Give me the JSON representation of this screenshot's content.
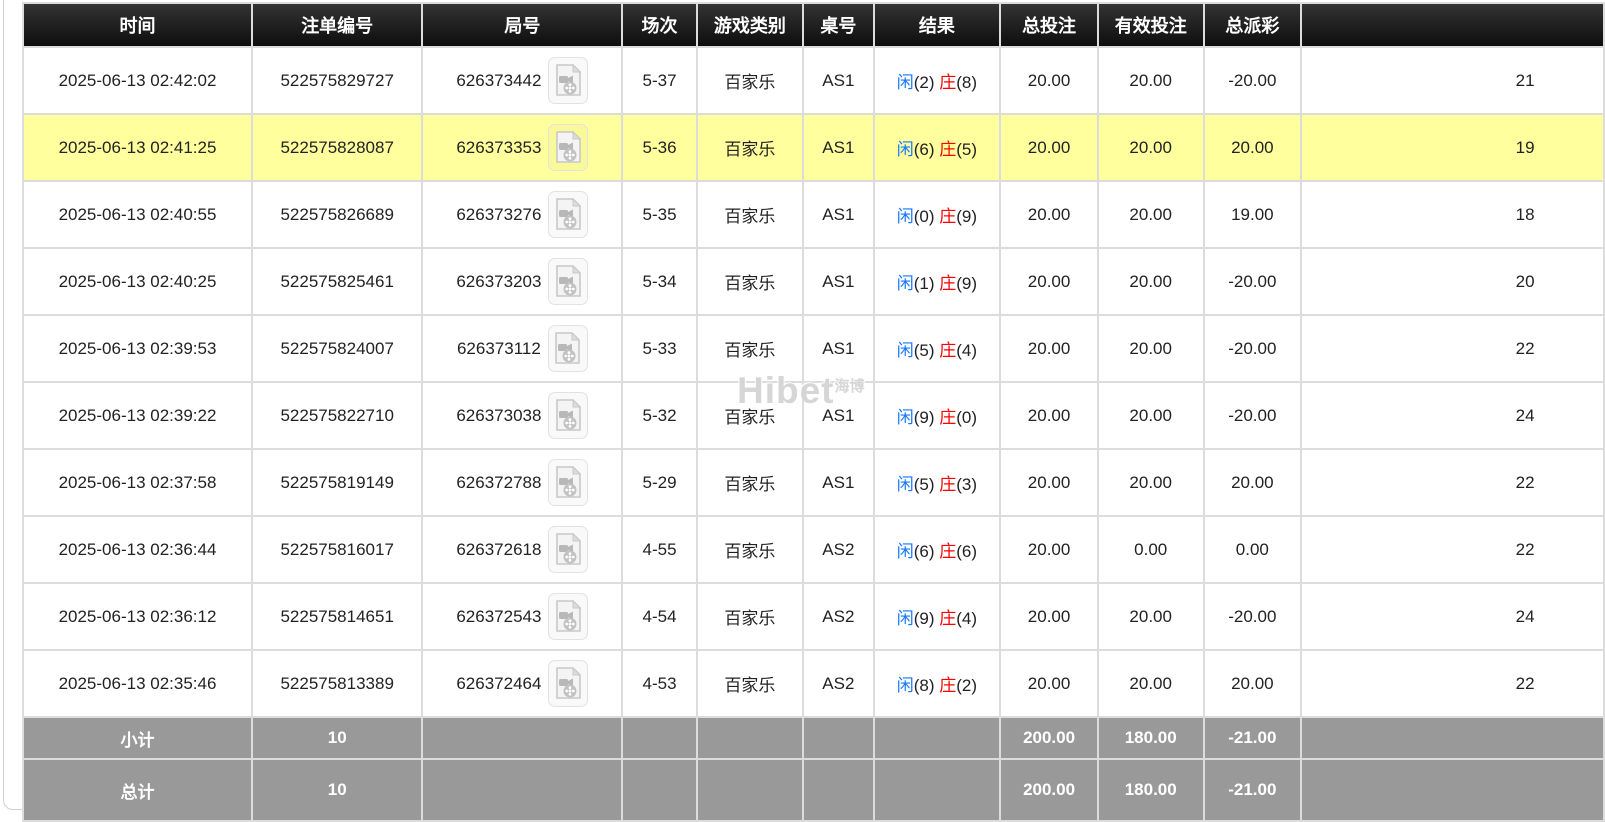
{
  "colors": {
    "accent_blue": "#1677ff",
    "negative_red": "#ff0000",
    "highlight_row": "#ffff9e",
    "header_bg": "#1a1a1a",
    "totals_bg": "#999999"
  },
  "watermark": {
    "text": "Hibet",
    "suffix": "海博"
  },
  "table": {
    "columns": [
      {
        "key": "time",
        "label": "时间"
      },
      {
        "key": "bet_id",
        "label": "注单编号"
      },
      {
        "key": "round_id",
        "label": "局号"
      },
      {
        "key": "session",
        "label": "场次"
      },
      {
        "key": "game",
        "label": "游戏类别"
      },
      {
        "key": "table_no",
        "label": "桌号"
      },
      {
        "key": "result",
        "label": "结果"
      },
      {
        "key": "total_bet",
        "label": "总投注"
      },
      {
        "key": "valid_bet",
        "label": "有效投注"
      },
      {
        "key": "payout",
        "label": "总派彩"
      },
      {
        "key": "balance",
        "label": ""
      }
    ],
    "video_icon_name": "video-replay-icon",
    "rows": [
      {
        "time": "2025-06-13 02:42:02",
        "bet_id": "522575829727",
        "round_id": "626373442",
        "session": "5-37",
        "game": "百家乐",
        "table_no": "AS1",
        "result": {
          "player_label": "闲",
          "player_value": "(2)",
          "banker_label": "庄",
          "banker_value": "(8)"
        },
        "total_bet": "20.00",
        "valid_bet": "20.00",
        "payout": "-20.00",
        "balance_partial": "21",
        "highlighted": false
      },
      {
        "time": "2025-06-13 02:41:25",
        "bet_id": "522575828087",
        "round_id": "626373353",
        "session": "5-36",
        "game": "百家乐",
        "table_no": "AS1",
        "result": {
          "player_label": "闲",
          "player_value": "(6)",
          "banker_label": "庄",
          "banker_value": "(5)"
        },
        "total_bet": "20.00",
        "valid_bet": "20.00",
        "payout": "20.00",
        "balance_partial": "19",
        "highlighted": true
      },
      {
        "time": "2025-06-13 02:40:55",
        "bet_id": "522575826689",
        "round_id": "626373276",
        "session": "5-35",
        "game": "百家乐",
        "table_no": "AS1",
        "result": {
          "player_label": "闲",
          "player_value": "(0)",
          "banker_label": "庄",
          "banker_value": "(9)"
        },
        "total_bet": "20.00",
        "valid_bet": "20.00",
        "payout": "19.00",
        "balance_partial": "18",
        "highlighted": false
      },
      {
        "time": "2025-06-13 02:40:25",
        "bet_id": "522575825461",
        "round_id": "626373203",
        "session": "5-34",
        "game": "百家乐",
        "table_no": "AS1",
        "result": {
          "player_label": "闲",
          "player_value": "(1)",
          "banker_label": "庄",
          "banker_value": "(9)"
        },
        "total_bet": "20.00",
        "valid_bet": "20.00",
        "payout": "-20.00",
        "balance_partial": "20",
        "highlighted": false
      },
      {
        "time": "2025-06-13 02:39:53",
        "bet_id": "522575824007",
        "round_id": "626373112",
        "session": "5-33",
        "game": "百家乐",
        "table_no": "AS1",
        "result": {
          "player_label": "闲",
          "player_value": "(5)",
          "banker_label": "庄",
          "banker_value": "(4)"
        },
        "total_bet": "20.00",
        "valid_bet": "20.00",
        "payout": "-20.00",
        "balance_partial": "22",
        "highlighted": false
      },
      {
        "time": "2025-06-13 02:39:22",
        "bet_id": "522575822710",
        "round_id": "626373038",
        "session": "5-32",
        "game": "百家乐",
        "table_no": "AS1",
        "result": {
          "player_label": "闲",
          "player_value": "(9)",
          "banker_label": "庄",
          "banker_value": "(0)"
        },
        "total_bet": "20.00",
        "valid_bet": "20.00",
        "payout": "-20.00",
        "balance_partial": "24",
        "highlighted": false
      },
      {
        "time": "2025-06-13 02:37:58",
        "bet_id": "522575819149",
        "round_id": "626372788",
        "session": "5-29",
        "game": "百家乐",
        "table_no": "AS1",
        "result": {
          "player_label": "闲",
          "player_value": "(5)",
          "banker_label": "庄",
          "banker_value": "(3)"
        },
        "total_bet": "20.00",
        "valid_bet": "20.00",
        "payout": "20.00",
        "balance_partial": "22",
        "highlighted": false
      },
      {
        "time": "2025-06-13 02:36:44",
        "bet_id": "522575816017",
        "round_id": "626372618",
        "session": "4-55",
        "game": "百家乐",
        "table_no": "AS2",
        "result": {
          "player_label": "闲",
          "player_value": "(6)",
          "banker_label": "庄",
          "banker_value": "(6)"
        },
        "total_bet": "20.00",
        "valid_bet": "0.00",
        "payout": "0.00",
        "balance_partial": "22",
        "highlighted": false
      },
      {
        "time": "2025-06-13 02:36:12",
        "bet_id": "522575814651",
        "round_id": "626372543",
        "session": "4-54",
        "game": "百家乐",
        "table_no": "AS2",
        "result": {
          "player_label": "闲",
          "player_value": "(9)",
          "banker_label": "庄",
          "banker_value": "(4)"
        },
        "total_bet": "20.00",
        "valid_bet": "20.00",
        "payout": "-20.00",
        "balance_partial": "24",
        "highlighted": false
      },
      {
        "time": "2025-06-13 02:35:46",
        "bet_id": "522575813389",
        "round_id": "626372464",
        "session": "4-53",
        "game": "百家乐",
        "table_no": "AS2",
        "result": {
          "player_label": "闲",
          "player_value": "(8)",
          "banker_label": "庄",
          "banker_value": "(2)"
        },
        "total_bet": "20.00",
        "valid_bet": "20.00",
        "payout": "20.00",
        "balance_partial": "22",
        "highlighted": false
      }
    ],
    "subtotal": {
      "label": "小计",
      "count": "10",
      "total_bet": "200.00",
      "valid_bet": "180.00",
      "payout": "-21.00"
    },
    "grand_total": {
      "label": "总计",
      "count": "10",
      "total_bet": "200.00",
      "valid_bet": "180.00",
      "payout": "-21.00"
    }
  }
}
